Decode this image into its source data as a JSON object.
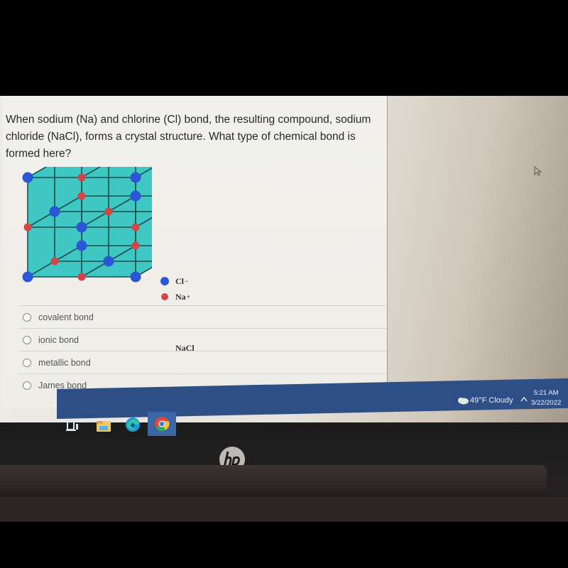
{
  "question": {
    "text": "When sodium (Na) and chlorine (Cl)  bond, the resulting compound, sodium chloride (NaCl), forms a crystal structure. What type of chemical bond is formed here?"
  },
  "figure": {
    "legend": [
      {
        "symbol": "Cl",
        "charge": "−",
        "color": "#2b57d6",
        "icon": "blue-dot"
      },
      {
        "symbol": "Na",
        "charge": "+",
        "color": "#d64545",
        "icon": "red-dot"
      }
    ],
    "caption": "NaCl",
    "lattice_fill": "#3fc7c4"
  },
  "options": [
    {
      "label": "covalent bond",
      "selected": false
    },
    {
      "label": "ionic bond",
      "selected": false
    },
    {
      "label": "metallic bond",
      "selected": false
    },
    {
      "label": "James bond",
      "selected": false
    }
  ],
  "taskbar": {
    "apps": [
      "task-view",
      "file-explorer",
      "edge",
      "chrome"
    ],
    "weather": "49°F  Cloudy",
    "time": "5:21 AM",
    "date": "3/22/2022"
  },
  "device": {
    "brand": "hp"
  }
}
